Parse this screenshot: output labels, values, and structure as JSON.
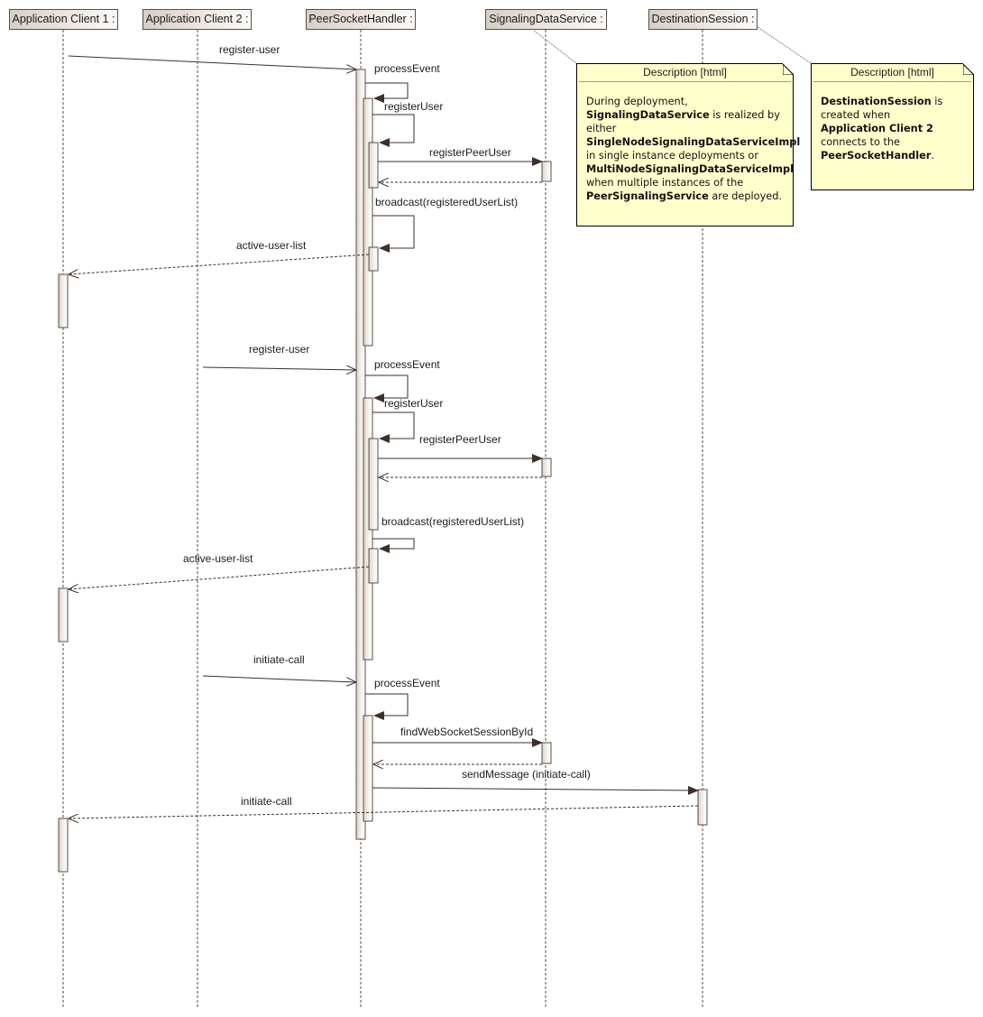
{
  "diagram": {
    "type": "UML sequence diagram",
    "lifelines": [
      {
        "id": "client1",
        "label": "Application Client 1 :"
      },
      {
        "id": "client2",
        "label": "Application Client 2 :"
      },
      {
        "id": "handler",
        "label": "PeerSocketHandler :"
      },
      {
        "id": "sds",
        "label": "SignalingDataService :"
      },
      {
        "id": "dest",
        "label": "DestinationSession :"
      }
    ],
    "messages": [
      {
        "label": "register-user",
        "from": "client1",
        "to": "handler",
        "kind": "async"
      },
      {
        "label": "processEvent",
        "from": "handler",
        "to": "handler",
        "kind": "self"
      },
      {
        "label": "registerUser",
        "from": "handler",
        "to": "handler",
        "kind": "self"
      },
      {
        "label": "registerPeerUser",
        "from": "handler",
        "to": "sds",
        "kind": "sync"
      },
      {
        "label": "",
        "from": "sds",
        "to": "handler",
        "kind": "return"
      },
      {
        "label": "broadcast(registeredUserList)",
        "from": "handler",
        "to": "handler",
        "kind": "self"
      },
      {
        "label": "active-user-list",
        "from": "handler",
        "to": "client1",
        "kind": "return"
      },
      {
        "label": "register-user",
        "from": "client2",
        "to": "handler",
        "kind": "async"
      },
      {
        "label": "processEvent",
        "from": "handler",
        "to": "handler",
        "kind": "self"
      },
      {
        "label": "registerUser",
        "from": "handler",
        "to": "handler",
        "kind": "self"
      },
      {
        "label": "registerPeerUser",
        "from": "handler",
        "to": "sds",
        "kind": "sync"
      },
      {
        "label": "",
        "from": "sds",
        "to": "handler",
        "kind": "return"
      },
      {
        "label": "broadcast(registeredUserList)",
        "from": "handler",
        "to": "handler",
        "kind": "self"
      },
      {
        "label": "active-user-list",
        "from": "handler",
        "to": "client1",
        "kind": "return"
      },
      {
        "label": "initiate-call",
        "from": "client2",
        "to": "handler",
        "kind": "async"
      },
      {
        "label": "processEvent",
        "from": "handler",
        "to": "handler",
        "kind": "self"
      },
      {
        "label": "findWebSocketSessionById",
        "from": "handler",
        "to": "sds",
        "kind": "sync"
      },
      {
        "label": "",
        "from": "sds",
        "to": "handler",
        "kind": "return"
      },
      {
        "label": "sendMessage (initiate-call)",
        "from": "handler",
        "to": "dest",
        "kind": "sync"
      },
      {
        "label": "initiate-call",
        "from": "dest",
        "to": "client1",
        "kind": "return"
      }
    ],
    "notes": [
      {
        "id": "note-sds",
        "attached_to": "sds",
        "title": "Description [html]",
        "lines": [
          [
            {
              "t": "During deployment,",
              "b": false
            }
          ],
          [
            {
              "t": "SignalingDataService",
              "b": true
            },
            {
              "t": " is realized by",
              "b": false
            }
          ],
          [
            {
              "t": "either",
              "b": false
            }
          ],
          [
            {
              "t": "SingleNodeSignalingDataServiceImpl",
              "b": true
            }
          ],
          [
            {
              "t": "in single instance deployments or",
              "b": false
            }
          ],
          [
            {
              "t": "MultiNodeSignalingDataServiceImpl",
              "b": true
            }
          ],
          [
            {
              "t": "when multiple instances of the",
              "b": false
            }
          ],
          [
            {
              "t": "PeerSignalingService",
              "b": true
            },
            {
              "t": " are deployed.",
              "b": false
            }
          ]
        ]
      },
      {
        "id": "note-dest",
        "attached_to": "dest",
        "title": "Description [html]",
        "lines": [
          [
            {
              "t": "DestinationSession",
              "b": true
            },
            {
              "t": " is",
              "b": false
            }
          ],
          [
            {
              "t": "created when",
              "b": false
            }
          ],
          [
            {
              "t": "Application Client 2",
              "b": true
            }
          ],
          [
            {
              "t": "connects to the",
              "b": false
            }
          ],
          [
            {
              "t": "PeerSocketHandler",
              "b": true
            },
            {
              "t": ".",
              "b": false
            }
          ]
        ]
      }
    ],
    "colors": {
      "line": "#3b302a",
      "lifeline": "#5a4e45",
      "activation_fill": "#efebe6",
      "note_fill": "#ffffcc"
    }
  }
}
